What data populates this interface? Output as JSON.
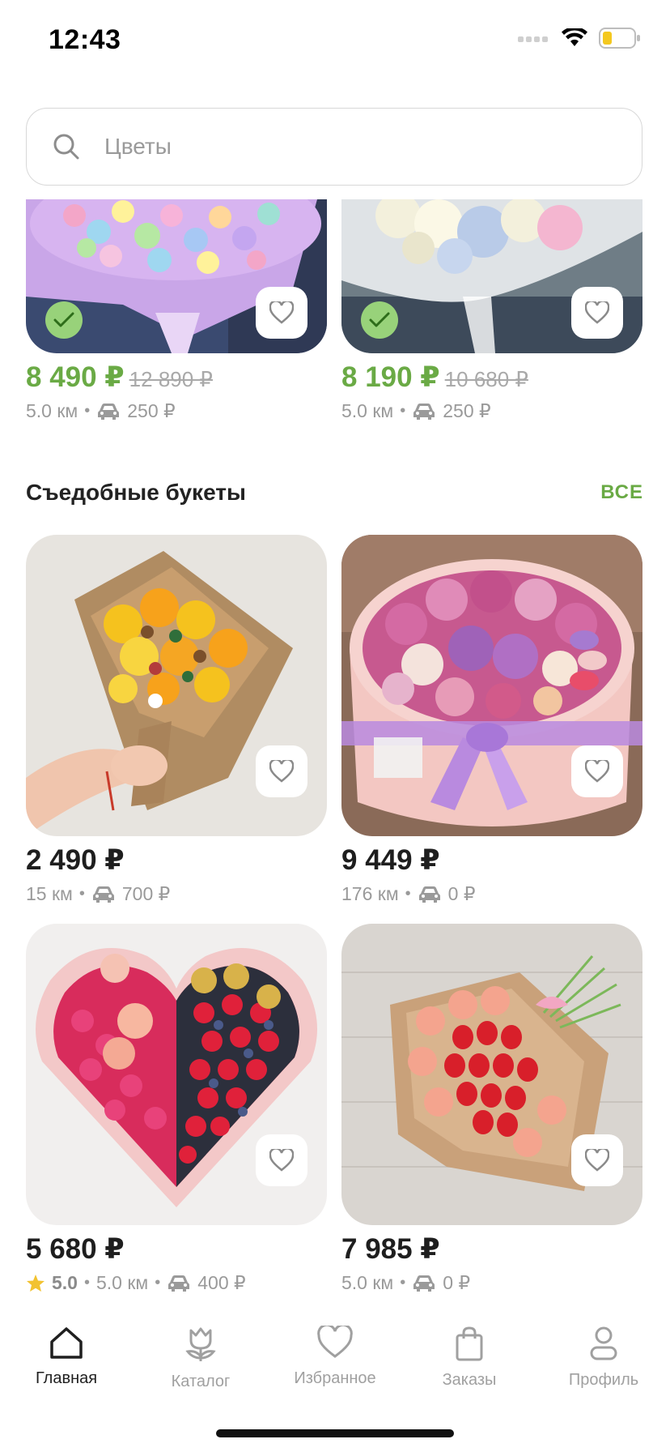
{
  "status_bar": {
    "time": "12:43"
  },
  "search": {
    "placeholder": "Цветы",
    "value": ""
  },
  "top_products": [
    {
      "price": "8 490 ₽",
      "old_price": "12 890 ₽",
      "distance": "5.0 км",
      "delivery": "250 ₽",
      "checked": true
    },
    {
      "price": "8 190 ₽",
      "old_price": "10 680 ₽",
      "distance": "5.0 км",
      "delivery": "250 ₽",
      "checked": true
    }
  ],
  "section": {
    "title": "Съедобные букеты",
    "all_label": "ВСЕ"
  },
  "products": [
    {
      "price": "2 490 ₽",
      "distance": "15 км",
      "delivery": "700 ₽"
    },
    {
      "price": "9 449 ₽",
      "distance": "176 км",
      "delivery": "0 ₽"
    },
    {
      "price": "5 680 ₽",
      "rating": "5.0",
      "distance": "5.0 км",
      "delivery": "400 ₽"
    },
    {
      "price": "7 985 ₽",
      "distance": "5.0 км",
      "delivery": "0 ₽"
    }
  ],
  "tabs": [
    {
      "label": "Главная",
      "icon": "home-icon",
      "active": true
    },
    {
      "label": "Каталог",
      "icon": "tulip-icon",
      "active": false
    },
    {
      "label": "Избранное",
      "icon": "heart-icon",
      "active": false
    },
    {
      "label": "Заказы",
      "icon": "bag-icon",
      "active": false
    },
    {
      "label": "Профиль",
      "icon": "profile-icon",
      "active": false
    }
  ],
  "colors": {
    "accent": "#6aaa45",
    "badge": "#98d27a",
    "muted": "#9a9a9a",
    "star": "#f2c230"
  },
  "meta_separator": "•"
}
